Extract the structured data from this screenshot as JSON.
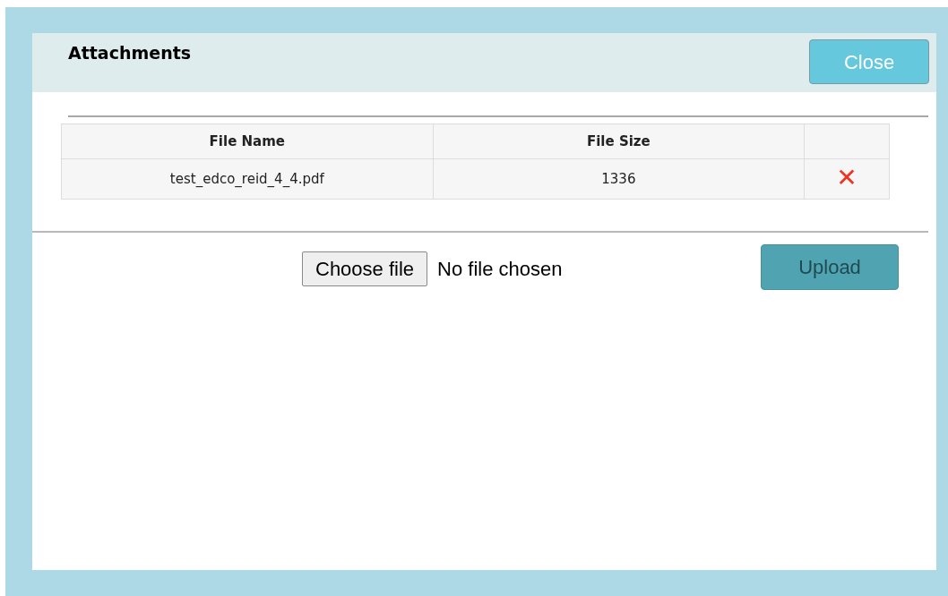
{
  "dialog": {
    "title": "Attachments",
    "close_button": "Close"
  },
  "table": {
    "columns": [
      "File Name",
      "File Size",
      ""
    ],
    "rows": [
      {
        "file_name": "test_edco_reid_4_4.pdf",
        "file_size": "1336",
        "delete": "✕"
      }
    ]
  },
  "file_input": {
    "button": "Choose file",
    "status": "No file chosen"
  },
  "upload_button": {
    "label": "Upload",
    "disabled": true
  }
}
